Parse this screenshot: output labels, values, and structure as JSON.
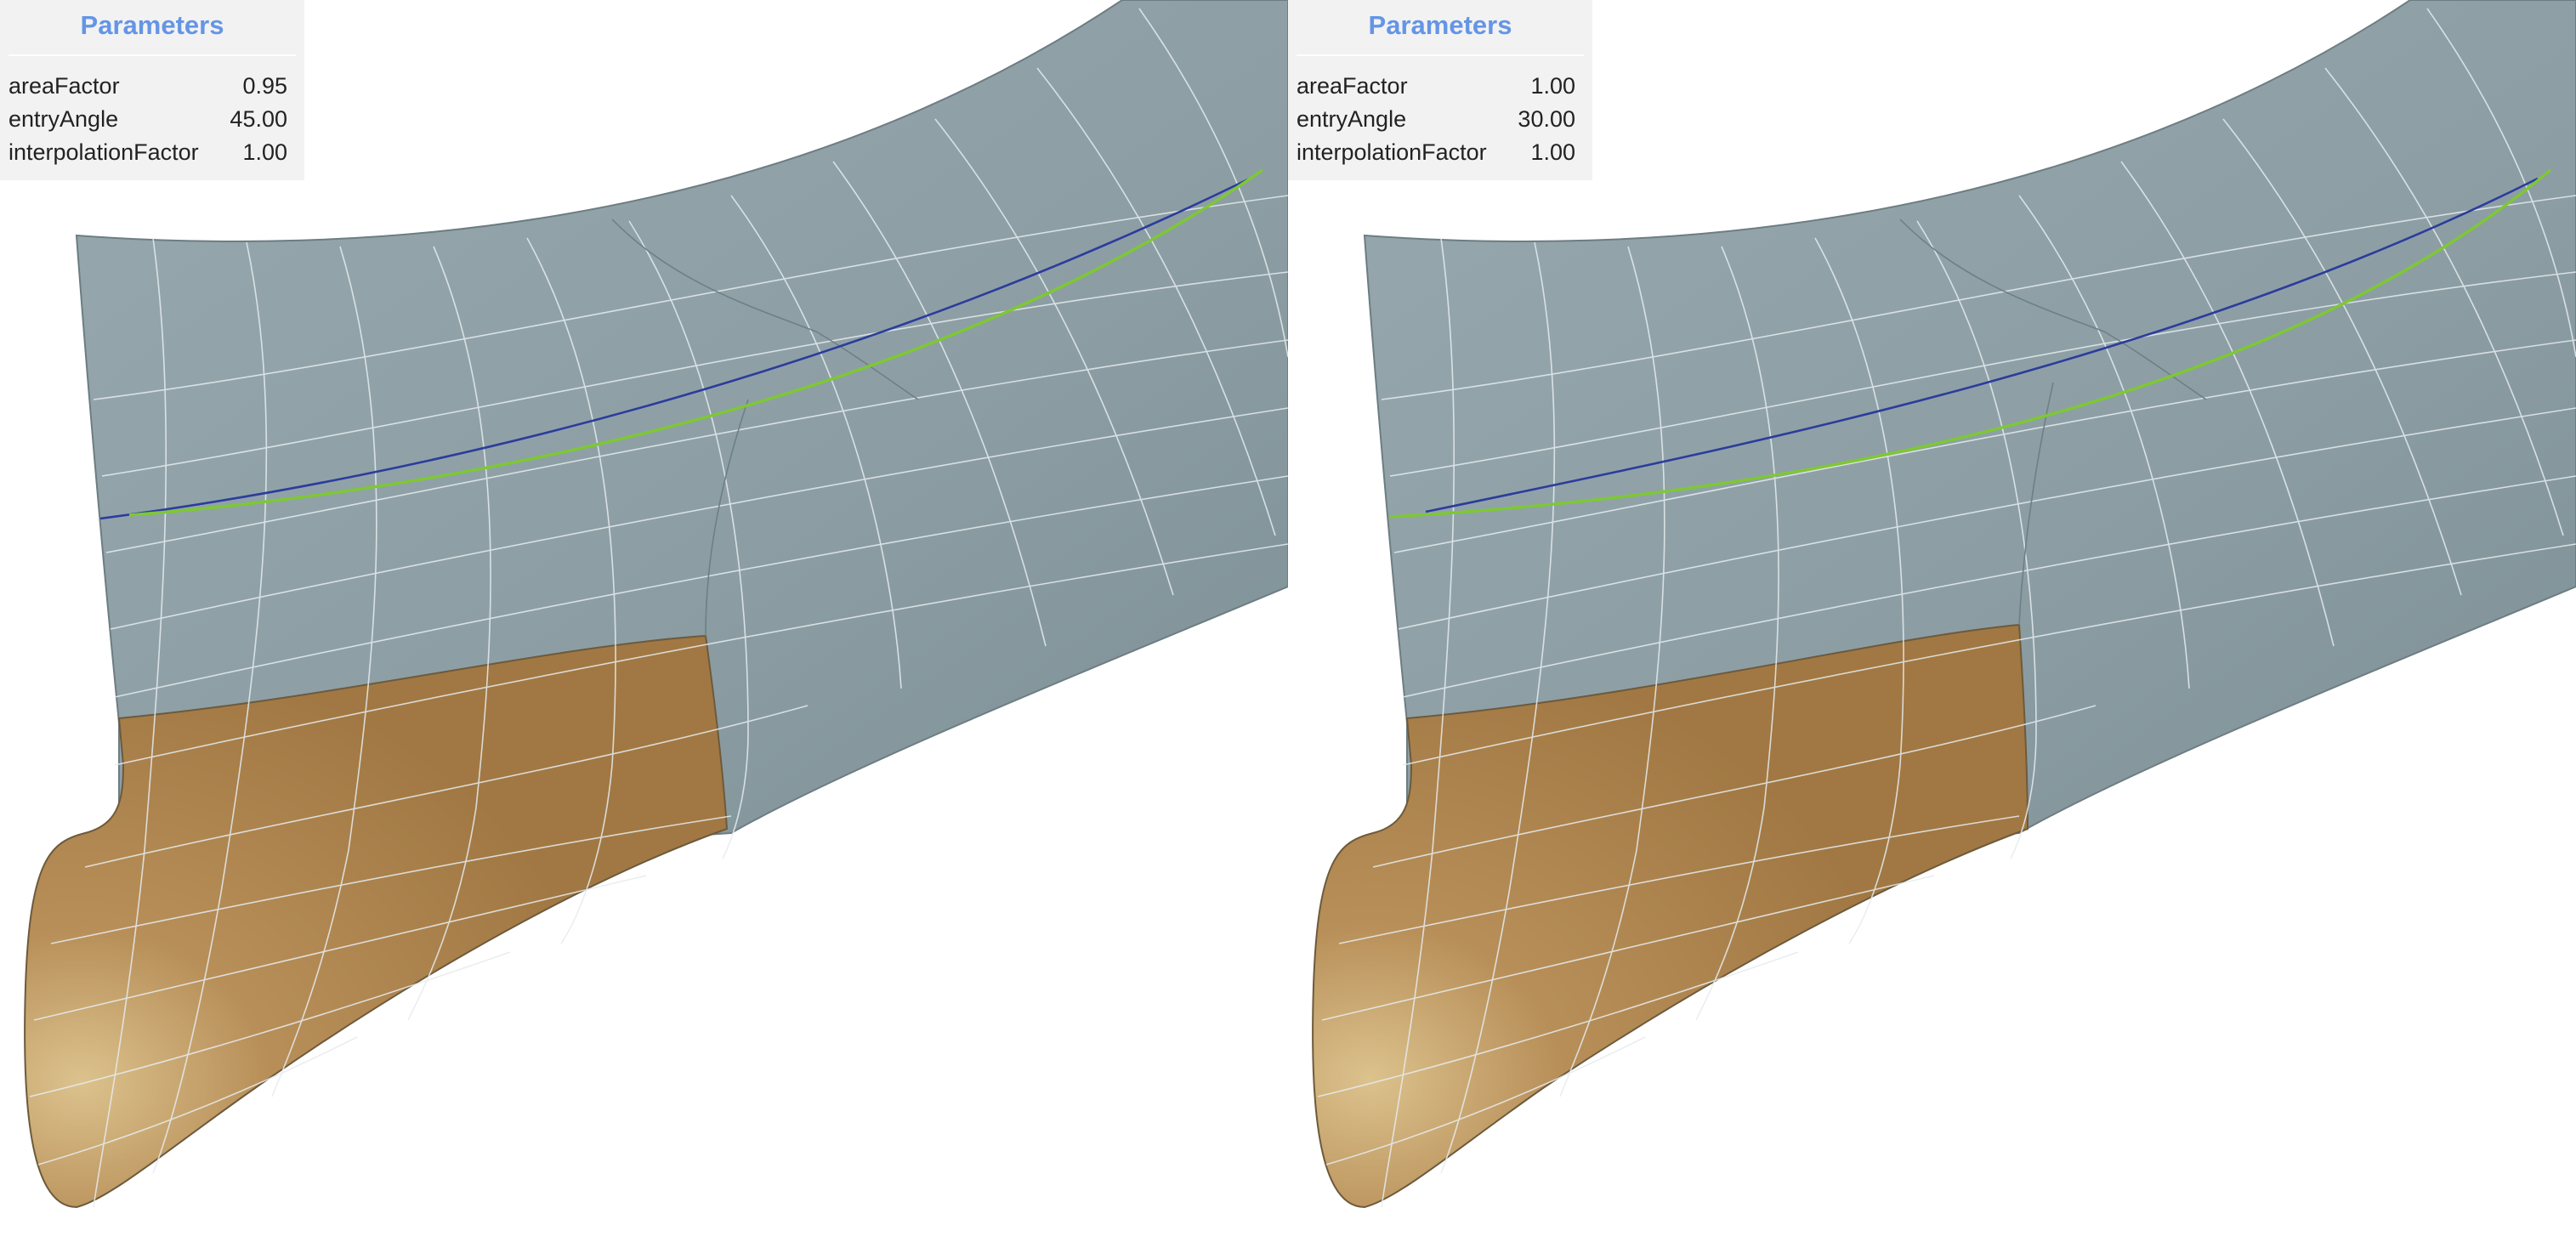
{
  "colors": {
    "hull": "#8fa1a7",
    "hull_dark": "#7f9298",
    "bulb": "#a9814d",
    "bulb_highlight": "#dcc28d",
    "grid_line": "#e6ecee",
    "blue_curve": "#2c3c9c",
    "green_curve": "#7ec832",
    "panel_bg": "#f2f2f2",
    "panel_title": "#6495e6"
  },
  "viewports": [
    {
      "panel": {
        "title": "Parameters",
        "rows": [
          {
            "label": "areaFactor",
            "value": "0.95"
          },
          {
            "label": "entryAngle",
            "value": "45.00"
          },
          {
            "label": "interpolationFactor",
            "value": "1.00"
          }
        ]
      }
    },
    {
      "panel": {
        "title": "Parameters",
        "rows": [
          {
            "label": "areaFactor",
            "value": "1.00"
          },
          {
            "label": "entryAngle",
            "value": "30.00"
          },
          {
            "label": "interpolationFactor",
            "value": "1.00"
          }
        ]
      }
    }
  ]
}
